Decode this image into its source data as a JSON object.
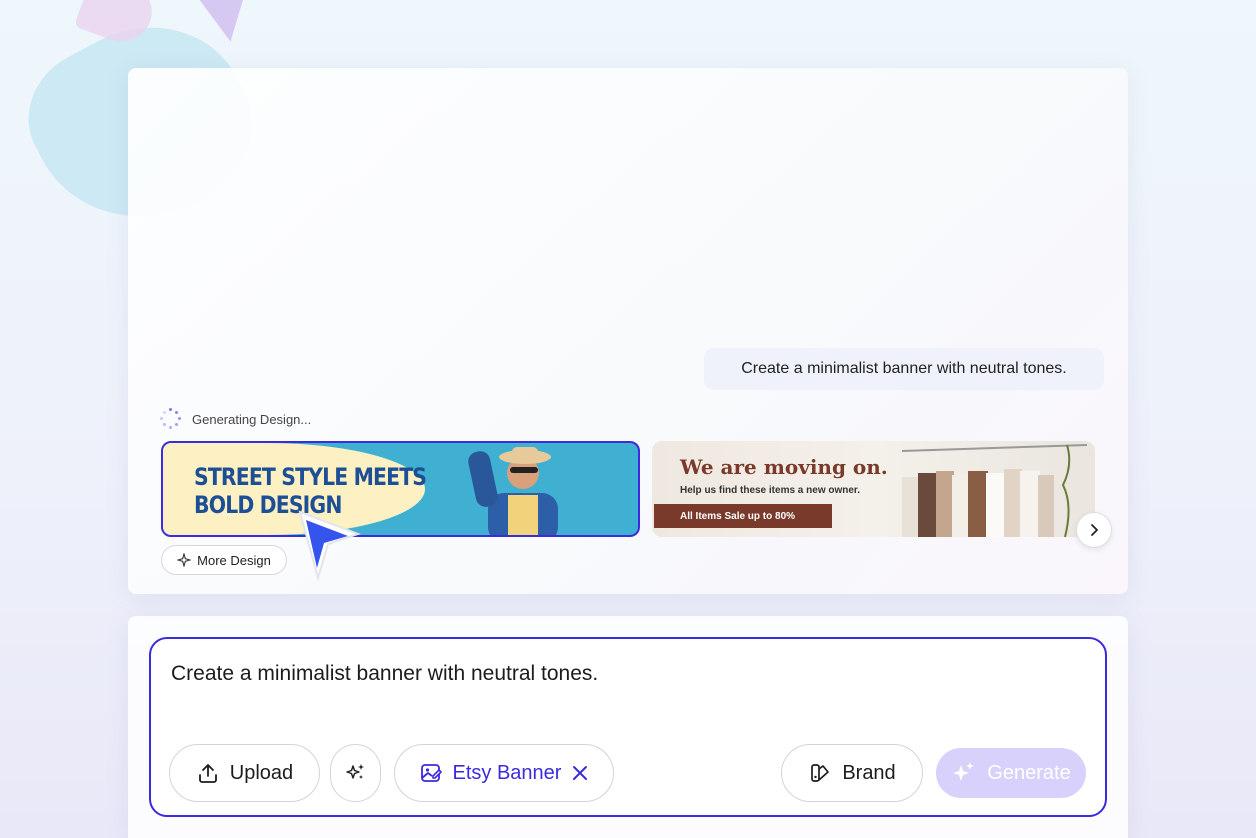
{
  "chat": {
    "user_message": "Create a minimalist banner with neutral tones.",
    "status": "Generating Design..."
  },
  "designs": [
    {
      "headline_line1": "STREET STYLE MEETS",
      "headline_line2": "BOLD DESIGN"
    },
    {
      "title": "We are moving on.",
      "subtitle": "Help us find these items a new owner.",
      "sale_tag": "All Items Sale up to 80%"
    }
  ],
  "more_design_label": "More Design",
  "composer": {
    "prompt_text": "Create a minimalist banner with neutral tones.",
    "upload_label": "Upload",
    "template_chip_label": "Etsy Banner",
    "brand_label": "Brand",
    "generate_label": "Generate"
  },
  "colors": {
    "accent": "#3a2bdc",
    "generate_disabled": "#d8d1fb"
  },
  "icons": [
    "upload-icon",
    "magic-sparkle-icon",
    "image-edit-icon",
    "close-icon",
    "brand-icon",
    "sparkle-icon",
    "chevron-right-icon",
    "spinner-icon",
    "cursor-pointer-icon"
  ]
}
